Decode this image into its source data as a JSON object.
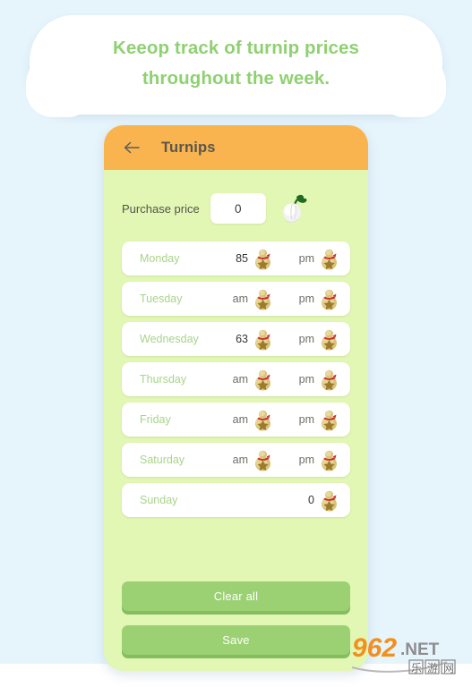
{
  "banner": {
    "line1": "Keeop track of turnip prices",
    "line2": "throughout the week.",
    "text_color": "#8fd171"
  },
  "appbar": {
    "back_icon": "arrow-left-icon",
    "title": "Turnips",
    "background_color": "#f9b450",
    "title_color": "#58564f"
  },
  "purchase": {
    "label": "Purchase price",
    "value": "0",
    "placeholder": "0",
    "icon": "turnip-icon"
  },
  "table": {
    "slot_labels": {
      "am": "am",
      "pm": "pm"
    },
    "currency_icon": "bell-bag-icon",
    "rows": [
      {
        "day": "Monday",
        "am_value": "85",
        "am_is_placeholder": false,
        "pm_value": "pm",
        "pm_is_placeholder": true,
        "single": false
      },
      {
        "day": "Tuesday",
        "am_value": "am",
        "am_is_placeholder": true,
        "pm_value": "pm",
        "pm_is_placeholder": true,
        "single": false
      },
      {
        "day": "Wednesday",
        "am_value": "63",
        "am_is_placeholder": false,
        "pm_value": "pm",
        "pm_is_placeholder": true,
        "single": false
      },
      {
        "day": "Thursday",
        "am_value": "am",
        "am_is_placeholder": true,
        "pm_value": "pm",
        "pm_is_placeholder": true,
        "single": false
      },
      {
        "day": "Friday",
        "am_value": "am",
        "am_is_placeholder": true,
        "pm_value": "pm",
        "pm_is_placeholder": true,
        "single": false
      },
      {
        "day": "Saturday",
        "am_value": "am",
        "am_is_placeholder": true,
        "pm_value": "pm",
        "pm_is_placeholder": true,
        "single": false
      },
      {
        "day": "Sunday",
        "am_value": "",
        "am_is_placeholder": true,
        "pm_value": "0",
        "pm_is_placeholder": false,
        "single": true
      }
    ]
  },
  "actions": {
    "clear_all": "Clear all",
    "save": "Save",
    "button_color": "#9bd173",
    "button_shadow_color": "#85bd60"
  },
  "panel": {
    "background_color": "#e2f7b3"
  },
  "page": {
    "background_color": "#e6f4fc"
  },
  "watermark": {
    "number": "962",
    "suffix": ".NET",
    "sub": "乐游网"
  }
}
